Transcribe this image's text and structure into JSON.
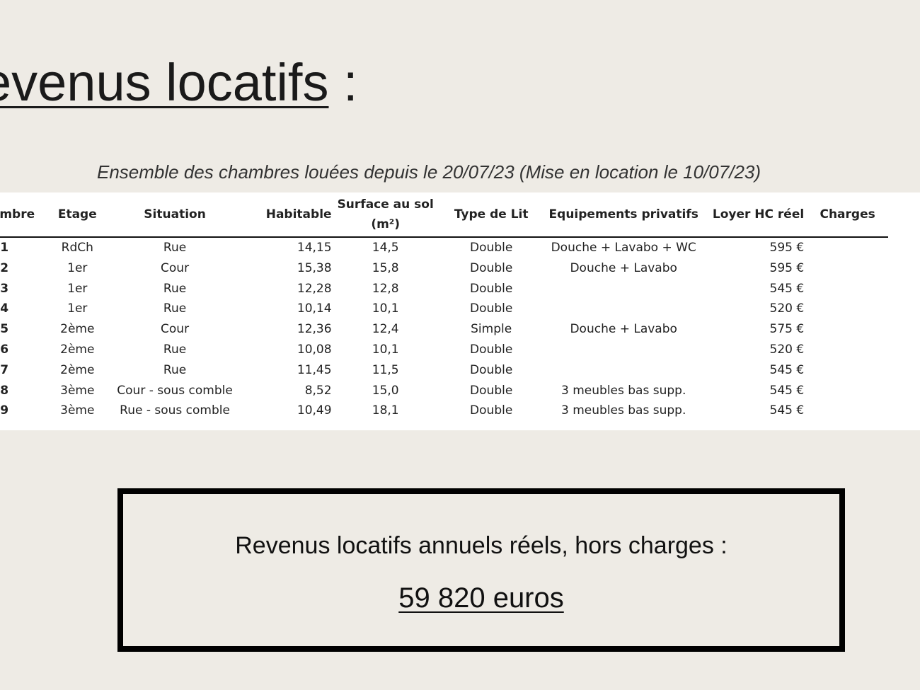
{
  "page": {
    "title_underlined": "evenus locatifs",
    "title_suffix": " :",
    "subtitle": "Ensemble des chambres louées depuis le 20/07/23 (Mise en location le 10/07/23)"
  },
  "table": {
    "headers": {
      "chambre": "Chambre",
      "etage": "Etage",
      "situation": "Situation",
      "habitable": "Habitable",
      "surface_line1": "Surface au sol",
      "surface_line2": "(m²)",
      "type_lit": "Type de Lit",
      "equipements": "Equipements privatifs",
      "loyer": "Loyer HC réel",
      "charges": "Charges"
    },
    "rows": [
      {
        "chambre": "1",
        "etage": "RdCh",
        "situation": "Rue",
        "habitable": "14,15",
        "surface": "14,5",
        "lit": "Double",
        "equipements": "Douche + Lavabo + WC",
        "loyer": "595 €"
      },
      {
        "chambre": "2",
        "etage": "1er",
        "situation": "Cour",
        "habitable": "15,38",
        "surface": "15,8",
        "lit": "Double",
        "equipements": "Douche + Lavabo",
        "loyer": "595 €"
      },
      {
        "chambre": "3",
        "etage": "1er",
        "situation": "Rue",
        "habitable": "12,28",
        "surface": "12,8",
        "lit": "Double",
        "equipements": "",
        "loyer": "545 €"
      },
      {
        "chambre": "4",
        "etage": "1er",
        "situation": "Rue",
        "habitable": "10,14",
        "surface": "10,1",
        "lit": "Double",
        "equipements": "",
        "loyer": "520 €"
      },
      {
        "chambre": "5",
        "etage": "2ème",
        "situation": "Cour",
        "habitable": "12,36",
        "surface": "12,4",
        "lit": "Simple",
        "equipements": "Douche + Lavabo",
        "loyer": "575 €"
      },
      {
        "chambre": "6",
        "etage": "2ème",
        "situation": "Rue",
        "habitable": "10,08",
        "surface": "10,1",
        "lit": "Double",
        "equipements": "",
        "loyer": "520 €"
      },
      {
        "chambre": "7",
        "etage": "2ème",
        "situation": "Rue",
        "habitable": "11,45",
        "surface": "11,5",
        "lit": "Double",
        "equipements": "",
        "loyer": "545 €"
      },
      {
        "chambre": "8",
        "etage": "3ème",
        "situation": "Cour - sous comble",
        "habitable": "8,52",
        "surface": "15,0",
        "lit": "Double",
        "equipements": "3 meubles bas supp.",
        "loyer": "545 €"
      },
      {
        "chambre": "9",
        "etage": "3ème",
        "situation": "Rue - sous comble",
        "habitable": "10,49",
        "surface": "18,1",
        "lit": "Double",
        "equipements": "3 meubles bas supp.",
        "loyer": "545 €"
      }
    ]
  },
  "summary": {
    "label": "Revenus locatifs annuels réels, hors charges :",
    "value": "59 820 euros"
  }
}
